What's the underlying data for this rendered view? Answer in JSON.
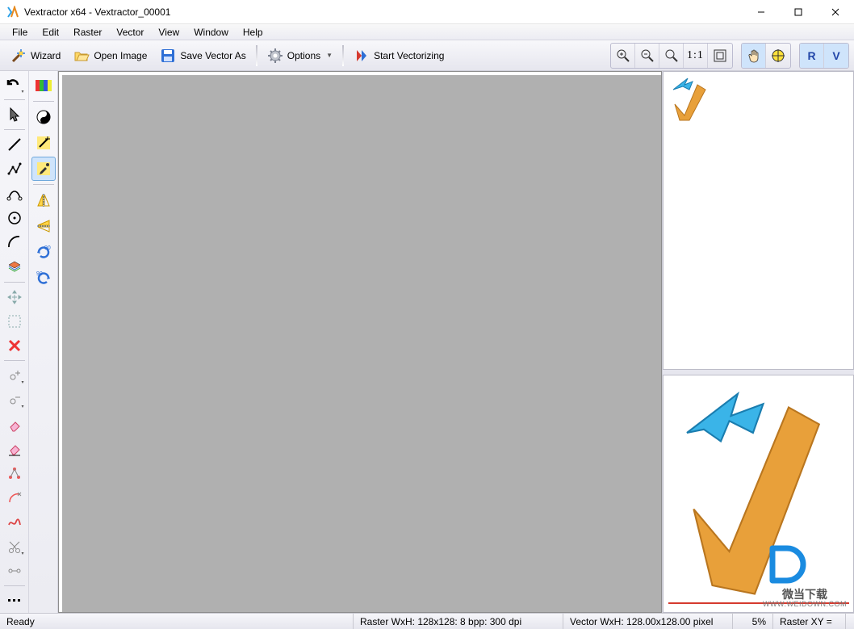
{
  "window": {
    "title": "Vextractor x64 - Vextractor_00001"
  },
  "menu": {
    "file": "File",
    "edit": "Edit",
    "raster": "Raster",
    "vector": "Vector",
    "view": "View",
    "window": "Window",
    "help": "Help"
  },
  "toolbar": {
    "wizard": "Wizard",
    "open_image": "Open Image",
    "save_vector_as": "Save Vector As",
    "options": "Options",
    "start_vectorizing": "Start Vectorizing",
    "one_to_one": "1:1",
    "r_label": "R",
    "v_label": "V"
  },
  "status": {
    "ready": "Ready",
    "raster": "Raster WxH: 128x128: 8 bpp: 300 dpi",
    "vector": "Vector WxH: 128.00x128.00 pixel",
    "zoom": "5%",
    "raster_xy": "Raster XY ="
  },
  "preview": {
    "watermark_zh": "微当下载",
    "watermark_url": "WWW.WEIDOWN.COM"
  }
}
